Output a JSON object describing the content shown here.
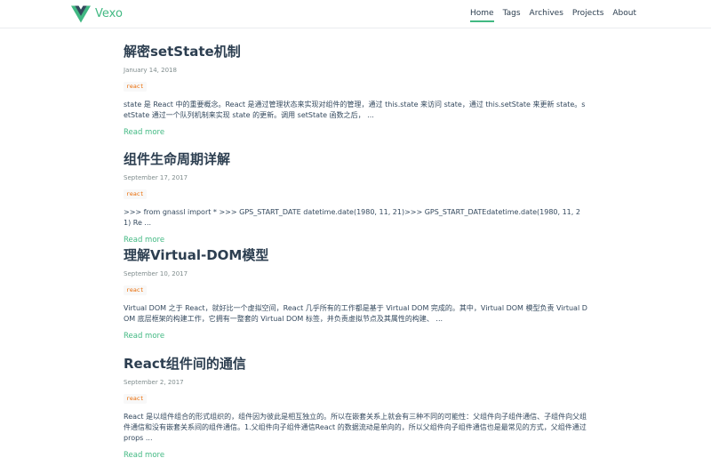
{
  "header": {
    "brand": "Vexo",
    "nav": [
      {
        "label": "Home",
        "active": true
      },
      {
        "label": "Tags",
        "active": false
      },
      {
        "label": "Archives",
        "active": false
      },
      {
        "label": "Projects",
        "active": false
      },
      {
        "label": "About",
        "active": false
      }
    ]
  },
  "colors": {
    "accent": "#42b983",
    "logo_dark": "#35495e",
    "tag": "#e96900"
  },
  "posts": [
    {
      "title": "解密setState机制",
      "date": "January 14, 2018",
      "tag": "react",
      "excerpt": "state 是 React 中的重要概念。React 是通过管理状态来实现对组件的管理，通过 this.state 来访问 state，通过 this.setState 来更新 state。setState 通过一个队列机制来实现 state 的更新。调用 setState 函数之后， ...",
      "read_more": "Read more"
    },
    {
      "title": "组件生命周期详解",
      "date": "September 17, 2017",
      "tag": "react",
      "excerpt": ">>> from gnassl import * >>> GPS_START_DATE datetime.date(1980, 11, 21)>>> GPS_START_DATEdatetime.date(1980, 11, 21) Re ...",
      "read_more": "Read more"
    },
    {
      "title": "理解Virtual-DOM模型",
      "date": "September 10, 2017",
      "tag": "react",
      "excerpt": "Virtual DOM 之于 React，就好比一个虚拟空间，React 几乎所有的工作都是基于 Virtual DOM 完成的。其中，Virtual DOM 模型负责 Virtual DOM 底层框架的构建工作，它拥有一整套的 Virtual DOM 标签，并负责虚拟节点及其属性的构建、 ...",
      "read_more": "Read more"
    },
    {
      "title": "React组件间的通信",
      "date": "September 2, 2017",
      "tag": "react",
      "excerpt": "React 是以组件组合的形式组织的，组件因为彼此是相互独立的。所以在嵌套关系上就会有三种不同的可能性：父组件向子组件通信、子组件向父组件通信和没有嵌套关系间的组件通信。1.父组件向子组件通信React 的数据流动是单向的，所以父组件向子组件通信也是最常见的方式，父组件通过 props ...",
      "read_more": "Read more"
    }
  ]
}
